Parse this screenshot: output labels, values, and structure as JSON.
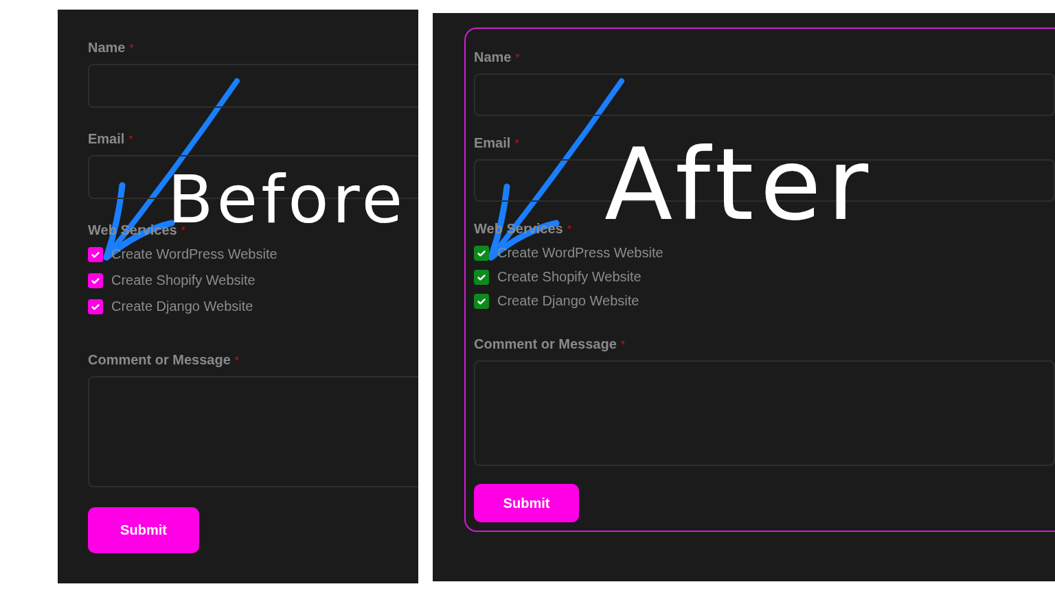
{
  "panels": [
    {
      "caption": "Before",
      "framed": false,
      "color": "#ff00e6",
      "fields": [
        {
          "kind": "input",
          "label": "Name",
          "required": "*"
        },
        {
          "kind": "input",
          "label": "Email",
          "required": "*"
        },
        {
          "kind": "checkboxes",
          "label": "Web Services",
          "required": "*",
          "options": [
            {
              "label": "Create WordPress Website",
              "checked": true
            },
            {
              "label": "Create Shopify Website",
              "checked": true
            },
            {
              "label": "Create Django Website",
              "checked": true
            }
          ]
        },
        {
          "kind": "textarea",
          "label": "Comment or Message",
          "required": "*"
        }
      ],
      "button": "Submit"
    },
    {
      "caption": "After",
      "framed": true,
      "color": "#0d8a1c",
      "fields": [
        {
          "kind": "input",
          "label": "Name",
          "required": "*"
        },
        {
          "kind": "input",
          "label": "Email",
          "required": "*"
        },
        {
          "kind": "checkboxes",
          "label": "Web Services",
          "required": "*",
          "options": [
            {
              "label": "Create WordPress Website",
              "checked": true
            },
            {
              "label": "Create Shopify Website",
              "checked": true
            },
            {
              "label": "Create Django Website",
              "checked": true
            }
          ]
        },
        {
          "kind": "textarea",
          "label": "Comment or Message",
          "required": "*"
        }
      ],
      "button": "Submit"
    }
  ]
}
